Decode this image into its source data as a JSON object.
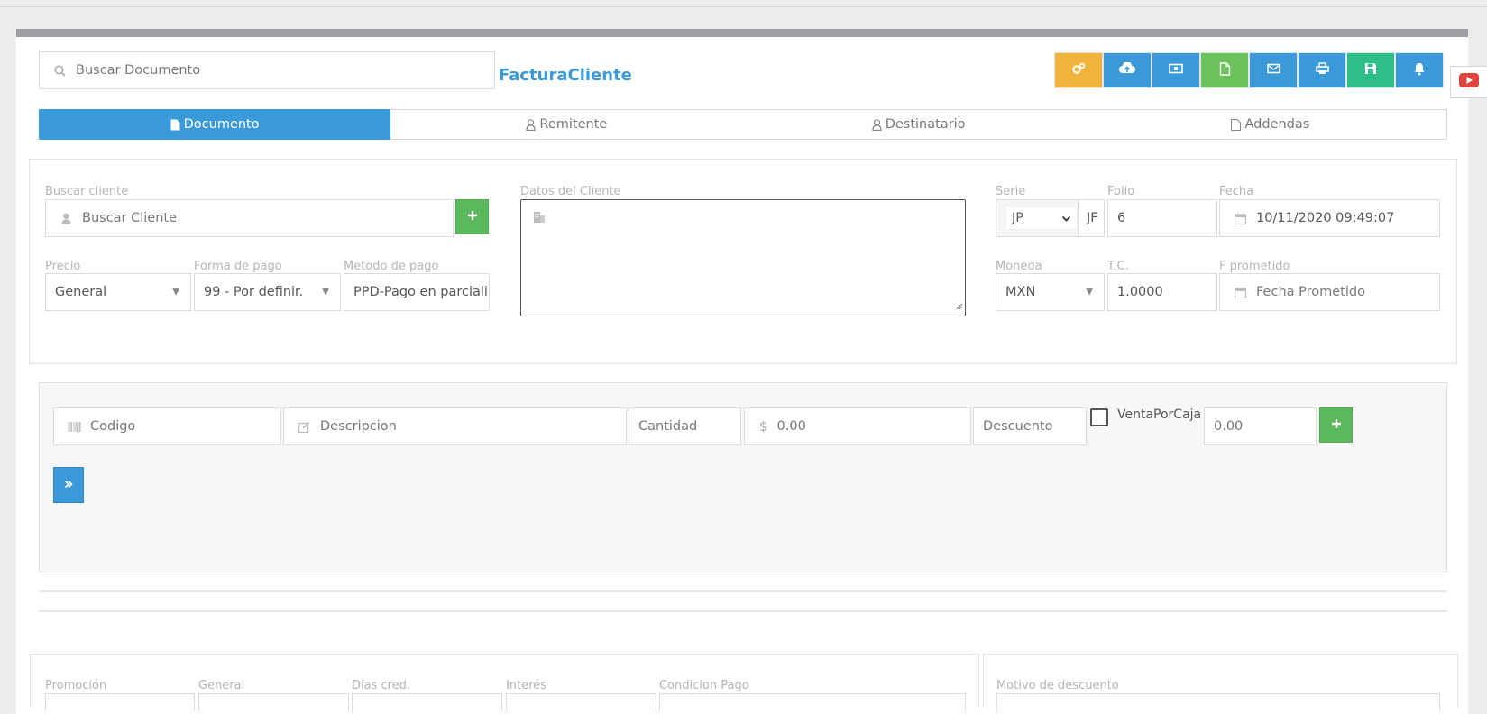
{
  "search_document": {
    "placeholder": "Buscar Documento"
  },
  "doc_title": "FacturaCliente",
  "toolbar": {
    "buttons": [
      {
        "icon": "gears-icon",
        "color": "#f0b43c"
      },
      {
        "icon": "cloud-upload-icon",
        "color": "#3a9ad9"
      },
      {
        "icon": "money-icon",
        "color": "#3a9ad9"
      },
      {
        "icon": "file-icon",
        "color": "#6cc25a"
      },
      {
        "icon": "envelope-icon",
        "color": "#3a9ad9"
      },
      {
        "icon": "print-icon",
        "color": "#3a9ad9"
      },
      {
        "icon": "save-icon",
        "color": "#2fbf8a"
      },
      {
        "icon": "bell-icon",
        "color": "#3a9ad9"
      }
    ]
  },
  "tabs": [
    {
      "label": "Documento",
      "icon": "file-icon",
      "active": true
    },
    {
      "label": "Remitente",
      "icon": "user-icon",
      "active": false
    },
    {
      "label": "Destinatario",
      "icon": "user-icon",
      "active": false
    },
    {
      "label": "Addendas",
      "icon": "file-outline-icon",
      "active": false
    }
  ],
  "client": {
    "search_label": "Buscar cliente",
    "search_placeholder": "Buscar Cliente",
    "data_label": "Datos del Cliente",
    "precio_label": "Precio",
    "precio_value": "General",
    "forma_pago_label": "Forma de pago",
    "forma_pago_value": "99 - Por definir.",
    "metodo_pago_label": "Metodo de pago",
    "metodo_pago_value": "PPD-Pago en parcialic"
  },
  "document": {
    "serie_label": "Serie",
    "serie_value": "JP",
    "serie_extra": "JF",
    "folio_label": "Folio",
    "folio_value": "6",
    "fecha_label": "Fecha",
    "fecha_value": "10/11/2020 09:49:07",
    "moneda_label": "Moneda",
    "moneda_value": "MXN",
    "tc_label": "T.C.",
    "tc_value": "1.0000",
    "fprometido_label": "F prometido",
    "fprometido_placeholder": "Fecha Prometido"
  },
  "item_entry": {
    "codigo_placeholder": "Codigo",
    "descripcion_placeholder": "Descripcion",
    "cantidad_placeholder": "Cantidad",
    "precio_currency": "$",
    "precio_placeholder": "0.00",
    "descuento_placeholder": "Descuento",
    "venta_por_caja_label": "VentaPorCaja",
    "total_placeholder": "0.00"
  },
  "bottom": {
    "promocion_label": "Promoción",
    "general_label": "General",
    "dias_cred_label": "Días cred.",
    "interes_label": "Interés",
    "condicion_pago_label": "Condicion Pago",
    "motivo_descuento_label": "Motivo de descuento"
  }
}
